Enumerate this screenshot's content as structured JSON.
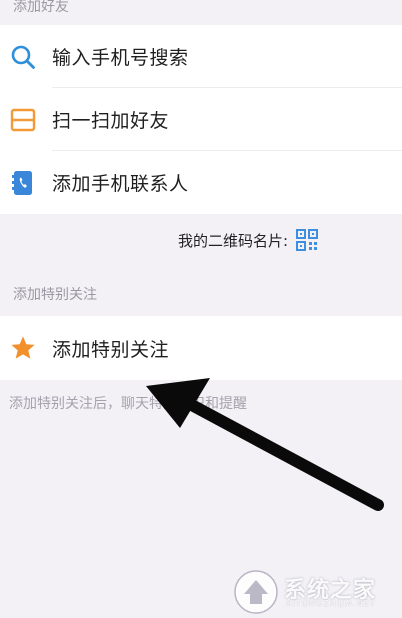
{
  "sections": {
    "add_friends_header": "添加好友",
    "special_header": "添加特别关注"
  },
  "rows": {
    "search_phone": "输入手机号搜索",
    "scan_add": "扫一扫加好友",
    "add_contacts": "添加手机联系人",
    "special_follow": "添加特别关注"
  },
  "qr_card": {
    "label": "我的二维码名片:"
  },
  "hint": "添加特别关注后，聊天特殊标识和提醒",
  "watermark": {
    "title": "系统之家",
    "subtitle": "XITONGZHIJIA.NET"
  },
  "colors": {
    "search_icon": "#2f8fd8",
    "scan_icon": "#f29a38",
    "contacts_icon": "#3a86d8",
    "star_icon": "#f2912c",
    "qr_icon": "#3d8fe0",
    "arrow": "#0a0a0a"
  },
  "icons": {
    "search": "search-icon",
    "scan": "scan-icon",
    "contacts": "phone-contacts-icon",
    "star": "star-icon",
    "qr": "qr-code-icon"
  }
}
